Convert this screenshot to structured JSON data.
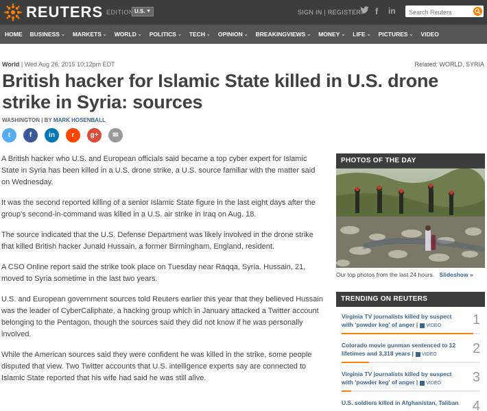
{
  "header": {
    "logo_text": "REUTERS",
    "edition_label": "EDITION:",
    "edition_value": "U.S.",
    "signin": "SIGN IN",
    "register": "REGISTER",
    "search_placeholder": "Search Reuters",
    "social": [
      "twitter-icon",
      "facebook-icon",
      "linkedin-icon"
    ]
  },
  "nav": {
    "items": [
      {
        "label": "HOME",
        "dropdown": false
      },
      {
        "label": "BUSINESS",
        "dropdown": true
      },
      {
        "label": "MARKETS",
        "dropdown": true
      },
      {
        "label": "WORLD",
        "dropdown": true
      },
      {
        "label": "POLITICS",
        "dropdown": true
      },
      {
        "label": "TECH",
        "dropdown": true
      },
      {
        "label": "OPINION",
        "dropdown": true
      },
      {
        "label": "BREAKINGVIEWS",
        "dropdown": true
      },
      {
        "label": "MONEY",
        "dropdown": true
      },
      {
        "label": "LIFE",
        "dropdown": true
      },
      {
        "label": "PICTURES",
        "dropdown": true
      },
      {
        "label": "VIDEO",
        "dropdown": false
      }
    ]
  },
  "article": {
    "section": "World",
    "dateline": "| Wed Aug 26, 2015 10:12pm EDT",
    "related": "Related: WORLD, SYRIA",
    "headline": "British hacker for Islamic State killed in U.S. drone strike in Syria: sources",
    "byline_location": "WASHINGTON | BY",
    "byline_author": "MARK HOSENBALL",
    "paragraphs": [
      "A British hacker who U.S. and European officials said became a top cyber expert for Islamic State in Syria has been killed in a U.S. drone strike, a U.S. source familiar with the matter said on Wednesday.",
      "It was the second reported killing of a senior Islamic State figure in the last eight days after the group's second-in-command was killed in a U.S. air strike in Iraq on Aug. 18.",
      "The source indicated that the U.S. Defense Department was likely involved in the drone strike that killed British hacker Junaid Hussain, a former Birmingham, England, resident.",
      "A CSO Online report said the strike took place on Tuesday near Raqqa, Syria. Hussain, 21, moved to Syria sometime in the last two years.",
      "U.S. and European government sources told Reuters earlier this year that they believed Hussain was the leader of CyberCaliphate, a hacking group which in January attacked a Twitter account belonging to the Pentagon, though the sources said they did not know if he was personally involved.",
      "While the American sources said they were confident he was killed in the strike, some people disputed that view. Two Twitter accounts that U.S. intelligence experts say are connected to Islamic State reported that his wife had said he was still alive."
    ],
    "share_icons": [
      {
        "name": "twitter-share-icon",
        "glyph": "t",
        "color": "#55acee"
      },
      {
        "name": "facebook-share-icon",
        "glyph": "f",
        "color": "#3b5998"
      },
      {
        "name": "linkedin-share-icon",
        "glyph": "in",
        "color": "#0077b5"
      },
      {
        "name": "reddit-share-icon",
        "glyph": "r",
        "color": "#ff4500"
      },
      {
        "name": "googleplus-share-icon",
        "glyph": "g+",
        "color": "#dd4b39"
      },
      {
        "name": "email-share-icon",
        "glyph": "✉",
        "color": "#999999"
      }
    ]
  },
  "sidebar": {
    "photos_title": "PHOTOS OF THE DAY",
    "photos_caption": "Our top photos from the last 24 hours.",
    "slideshow_link": "Slideshow »",
    "trending_title": "TRENDING ON REUTERS",
    "video_label": "VIDEO",
    "trending": [
      {
        "title": "Virginia TV journalists killed by suspect with 'powder keg' of anger |",
        "rank": "1",
        "video": true,
        "popularity": 0.95
      },
      {
        "title": "Colorado movie gunman sentenced to 12 lifetimes and 3,318 years |",
        "rank": "2",
        "video": true,
        "popularity": 0.2
      },
      {
        "title": "Virginia TV journalists killed by suspect with 'powder keg' of anger |",
        "rank": "3",
        "video": true,
        "popularity": 0.07
      },
      {
        "title": "U.S. soldiers killed in Afghanistan, Taliban",
        "rank": "4",
        "video": false,
        "popularity": 0.05
      }
    ]
  },
  "colors": {
    "accent": "#ff8000",
    "link": "#39648f",
    "topbar": "#3d3d3d",
    "nav": "#555555"
  }
}
